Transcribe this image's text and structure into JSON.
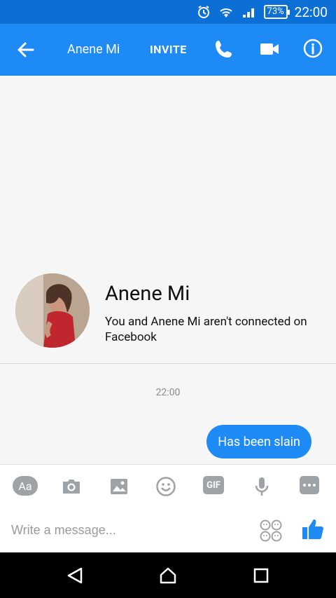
{
  "status_bar": {
    "battery": "73%",
    "time": "22:00",
    "icons": [
      "alarm-icon",
      "wifi-icon",
      "signal-icon",
      "battery-icon"
    ]
  },
  "header": {
    "title": "Anene Mi",
    "invite_label": "INVITE",
    "icons": [
      "back-arrow-icon",
      "phone-icon",
      "video-camera-icon",
      "info-icon"
    ]
  },
  "profile": {
    "name": "Anene Mi",
    "subtitle": "You and Anene Mi aren't connected on Facebook"
  },
  "conversation": {
    "timestamp": "22:00",
    "messages": [
      {
        "from": "me",
        "text": "Has been slain"
      }
    ]
  },
  "toolbar": {
    "aa_label": "Aa",
    "gif_label": "GIF",
    "icons": [
      "text-format-icon",
      "camera-icon",
      "image-icon",
      "emoji-icon",
      "gif-icon",
      "microphone-icon",
      "more-icon"
    ]
  },
  "composer": {
    "placeholder": "Write a message..."
  },
  "navigation": {
    "icons": [
      "back-nav-icon",
      "home-nav-icon",
      "recent-apps-nav-icon"
    ]
  },
  "colors": {
    "status_bar": "#0b6fd6",
    "app_bar": "#1d8af5",
    "bubble": "#1d8af5",
    "toolbar_icon": "#9ea3a8"
  }
}
